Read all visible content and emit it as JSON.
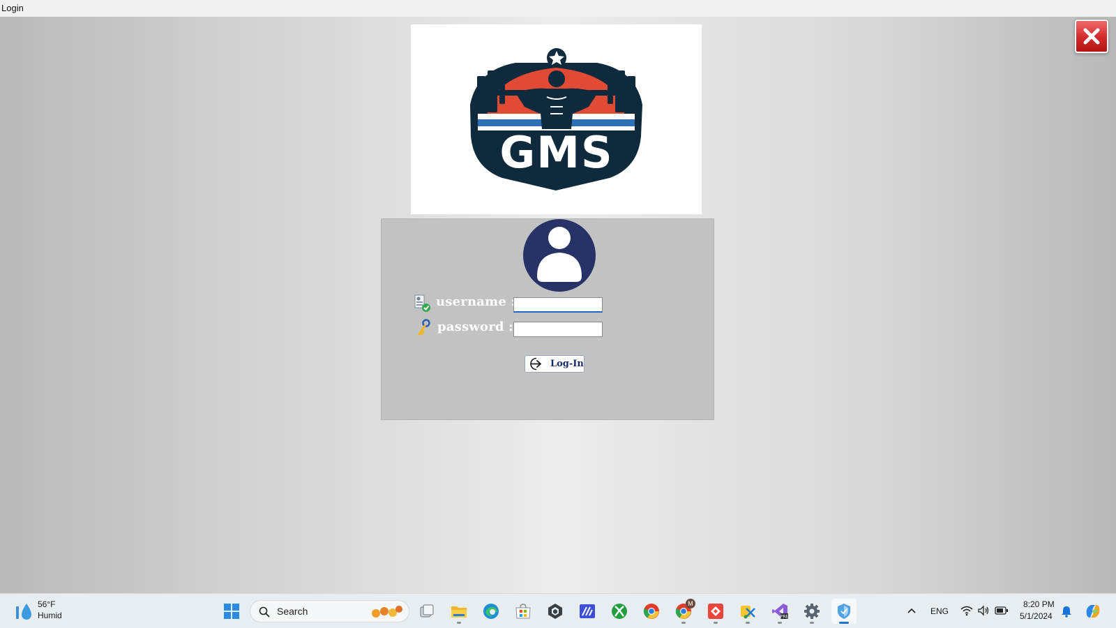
{
  "window": {
    "title": "Login",
    "close_icon": "close-x-icon"
  },
  "logo": {
    "text": "GMS",
    "description_icon": "gym-logo-icon"
  },
  "login": {
    "avatar_icon": "user-avatar-icon",
    "username_label": "username :",
    "username_value": "",
    "username_icon": "user-check-icon",
    "password_label": "password :",
    "password_value": "",
    "password_icon": "key-icon",
    "login_button_label": "Log-In",
    "login_button_icon": "login-arrow-icon"
  },
  "taskbar": {
    "weather_temp": "56°F",
    "weather_condition": "Humid",
    "search_placeholder": "Search",
    "apps": [
      "windows-start-icon",
      "task-view-icon",
      "file-explorer-icon",
      "edge-icon",
      "ms-store-icon",
      "unity-icon",
      "app-icon",
      "xbox-icon",
      "chrome-icon",
      "chrome-profile-icon",
      "anydesk-icon",
      "snipping-tool-icon",
      "visual-studio-preview-icon",
      "settings-icon",
      "security-shield-icon"
    ],
    "language": "ENG",
    "time": "8:20 PM",
    "date": "5/1/2024",
    "profile_badge": "M"
  },
  "colors": {
    "logo_navy": "#0f2a3d",
    "logo_red": "#e14a35",
    "logo_blue": "#2d6fb8",
    "avatar_navy": "#273266",
    "close_red": "#d22a2a",
    "login_text": "#1d2a6a"
  }
}
